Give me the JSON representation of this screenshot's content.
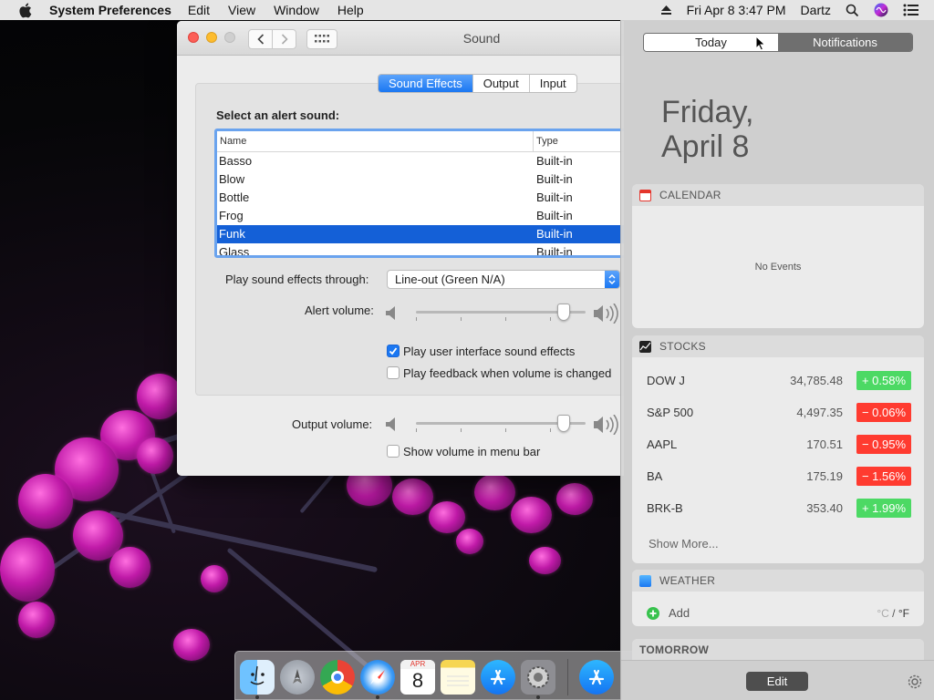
{
  "menubar": {
    "app_name": "System Preferences",
    "menus": [
      "Edit",
      "View",
      "Window",
      "Help"
    ],
    "clock": "Fri Apr 8  3:47 PM",
    "user": "Dartz"
  },
  "window": {
    "title": "Sound",
    "tabs": [
      "Sound Effects",
      "Output",
      "Input"
    ],
    "active_tab": "Sound Effects",
    "alert_heading": "Select an alert sound:",
    "columns": {
      "name": "Name",
      "type": "Type"
    },
    "sounds": [
      {
        "name": "Basso",
        "type": "Built-in"
      },
      {
        "name": "Blow",
        "type": "Built-in"
      },
      {
        "name": "Bottle",
        "type": "Built-in"
      },
      {
        "name": "Frog",
        "type": "Built-in"
      },
      {
        "name": "Funk",
        "type": "Built-in",
        "selected": true
      },
      {
        "name": "Glass",
        "type": "Built-in"
      }
    ],
    "play_through_label": "Play sound effects through:",
    "play_through_value": "Line-out (Green N/A)",
    "alert_volume_label": "Alert volume:",
    "alert_volume_level": 0.9,
    "ui_sounds_label": "Play user interface sound effects",
    "ui_sounds_checked": true,
    "feedback_label": "Play feedback when volume is changed",
    "feedback_checked": false,
    "output_volume_label": "Output volume:",
    "output_volume_level": 0.9,
    "show_volume_label": "Show volume in menu bar",
    "show_volume_checked": false
  },
  "notification_center": {
    "segment_today": "Today",
    "segment_notifications": "Notifications",
    "day_line": "Friday,",
    "date_line": "April 8",
    "calendar": {
      "title": "CALENDAR",
      "empty_text": "No Events"
    },
    "stocks": {
      "title": "STOCKS",
      "rows": [
        {
          "symbol": "DOW J",
          "price": "34,785.48",
          "change": "+ 0.58%",
          "direction": "up"
        },
        {
          "symbol": "S&P 500",
          "price": "4,497.35",
          "change": "− 0.06%",
          "direction": "down"
        },
        {
          "symbol": "AAPL",
          "price": "170.51",
          "change": "− 0.95%",
          "direction": "down"
        },
        {
          "symbol": "BA",
          "price": "175.19",
          "change": "− 1.56%",
          "direction": "down"
        },
        {
          "symbol": "BRK-B",
          "price": "353.40",
          "change": "+ 1.99%",
          "direction": "up"
        }
      ],
      "show_more": "Show More..."
    },
    "weather": {
      "title": "WEATHER",
      "add_label": "Add",
      "unit_c": "°C",
      "unit_separator": "/",
      "unit_f": "°F"
    },
    "tomorrow": {
      "title": "TOMORROW"
    },
    "edit_label": "Edit"
  },
  "dock": {
    "calendar_month": "APR",
    "calendar_day": "8",
    "apps": [
      "finder-icon",
      "launchpad-icon",
      "chrome-icon",
      "safari-icon",
      "calendar-icon",
      "notes-icon",
      "app-store-icon",
      "system-preferences-icon",
      "app-store-icon"
    ]
  },
  "colors": {
    "accent": "#1a77f2",
    "selection": "#1460d7",
    "stock_up": "#4cd964",
    "stock_down": "#ff3b30"
  }
}
